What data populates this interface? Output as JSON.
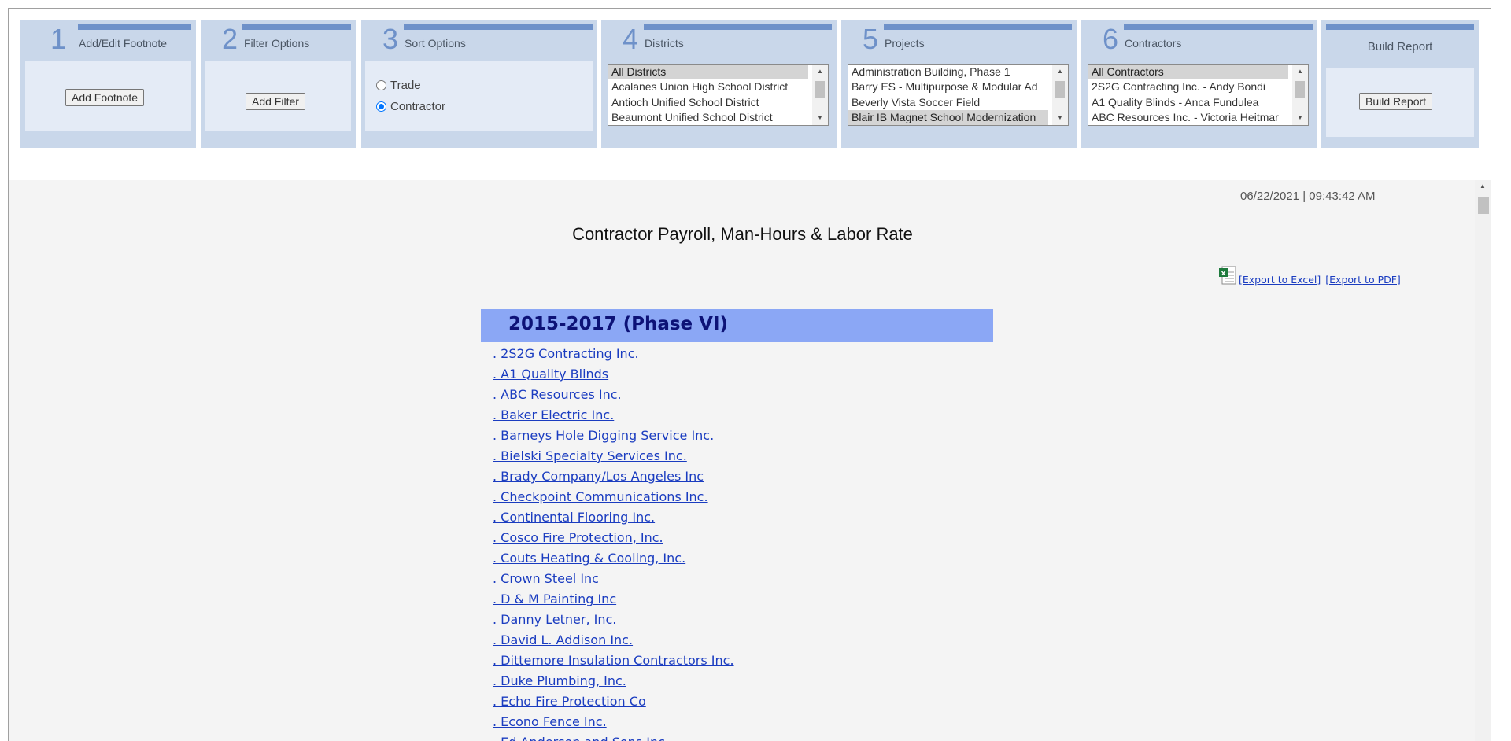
{
  "panels": {
    "footnote": {
      "number": "1",
      "title": "Add/Edit Footnote",
      "button_label": "Add Footnote"
    },
    "filter": {
      "number": "2",
      "title": "Filter Options",
      "button_label": "Add Filter"
    },
    "sort": {
      "number": "3",
      "title": "Sort Options",
      "options": [
        {
          "label": "Trade",
          "checked": false
        },
        {
          "label": "Contractor",
          "checked": true
        }
      ]
    },
    "districts": {
      "number": "4",
      "title": "Districts",
      "items": [
        {
          "label": "All Districts",
          "selected": true
        },
        {
          "label": "Acalanes Union High School District",
          "selected": false
        },
        {
          "label": "Antioch Unified School District",
          "selected": false
        },
        {
          "label": "Beaumont Unified School District",
          "selected": false
        }
      ]
    },
    "projects": {
      "number": "5",
      "title": "Projects",
      "items": [
        {
          "label": "Administration Building, Phase 1",
          "selected": false
        },
        {
          "label": "Barry ES - Multipurpose & Modular Ad",
          "selected": false
        },
        {
          "label": "Beverly Vista Soccer Field",
          "selected": false
        },
        {
          "label": "Blair IB Magnet School Modernization",
          "selected": true
        }
      ]
    },
    "contractors": {
      "number": "6",
      "title": "Contractors",
      "items": [
        {
          "label": "All Contractors",
          "selected": true
        },
        {
          "label": "2S2G Contracting Inc. - Andy Bondi",
          "selected": false
        },
        {
          "label": "A1 Quality Blinds - Anca Fundulea",
          "selected": false
        },
        {
          "label": "ABC Resources Inc. - Victoria Heitmar",
          "selected": false
        }
      ]
    },
    "build": {
      "title": "Build Report",
      "button_label": "Build Report"
    }
  },
  "report": {
    "timestamp": "06/22/2021 | 09:43:42 AM",
    "title": "Contractor Payroll, Man-Hours & Labor Rate",
    "export_excel": "[Export to Excel]",
    "export_pdf": "[Export to PDF]",
    "phase": "2015-2017 (Phase VI)",
    "contractors": [
      ". 2S2G Contracting Inc.",
      ". A1 Quality Blinds",
      ". ABC Resources Inc.",
      ". Baker Electric Inc.",
      ". Barneys Hole Digging Service Inc.",
      ". Bielski Specialty Services Inc.",
      ". Brady Company/Los Angeles Inc",
      ". Checkpoint Communications Inc.",
      ". Continental Flooring Inc.",
      ". Cosco Fire Protection, Inc.",
      ". Couts Heating & Cooling, Inc.",
      ". Crown Steel Inc",
      ". D & M Painting Inc",
      ". Danny Letner, Inc.",
      ". David L. Addison Inc.",
      ". Dittemore Insulation Contractors Inc.",
      ". Duke Plumbing, Inc.",
      ". Echo Fire Protection Co",
      ". Econo Fence Inc.",
      ". Ed Anderson and Sons Inc"
    ]
  },
  "colors": {
    "panel_bg": "#c9d7ea",
    "panel_accent": "#6e91c9",
    "phase_bg": "#8ba7f5",
    "link": "#1a3cc0"
  }
}
